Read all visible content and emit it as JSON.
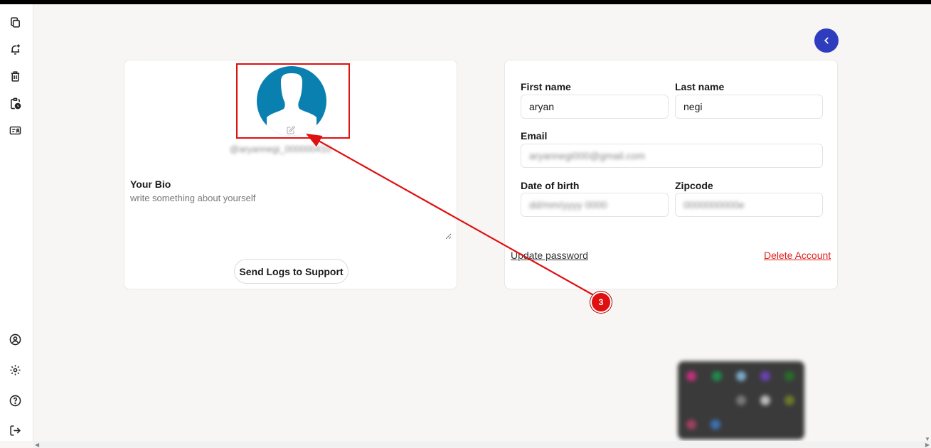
{
  "sidebar": {
    "top_icons": [
      "copy-icon",
      "bell-plus-icon",
      "trash-icon",
      "clipboard-clock-icon",
      "id-card-icon"
    ],
    "bottom_icons": [
      "user-circle-icon",
      "gear-icon",
      "help-circle-icon",
      "logout-icon"
    ]
  },
  "profile": {
    "username": "@aryannegi_000000410",
    "bio_label": "Your Bio",
    "bio_value": "",
    "bio_placeholder": "write something about yourself",
    "send_logs_label": "Send Logs to Support"
  },
  "form": {
    "first_name_label": "First name",
    "first_name_value": "aryan",
    "last_name_label": "Last name",
    "last_name_value": "negi",
    "email_label": "Email",
    "email_value": "aryannegi000@gmail.com",
    "dob_label": "Date of birth",
    "dob_value": "dd/mm/yyyy 0000",
    "zipcode_label": "Zipcode",
    "zipcode_value": "0000000000e",
    "update_password_label": "Update password",
    "delete_account_label": "Delete Account"
  },
  "annotation": {
    "step_number": "3",
    "color": "#e01010"
  },
  "colors": {
    "accent": "#2d3dbd",
    "avatar_bg": "#0a80b0",
    "danger": "#e02020"
  }
}
